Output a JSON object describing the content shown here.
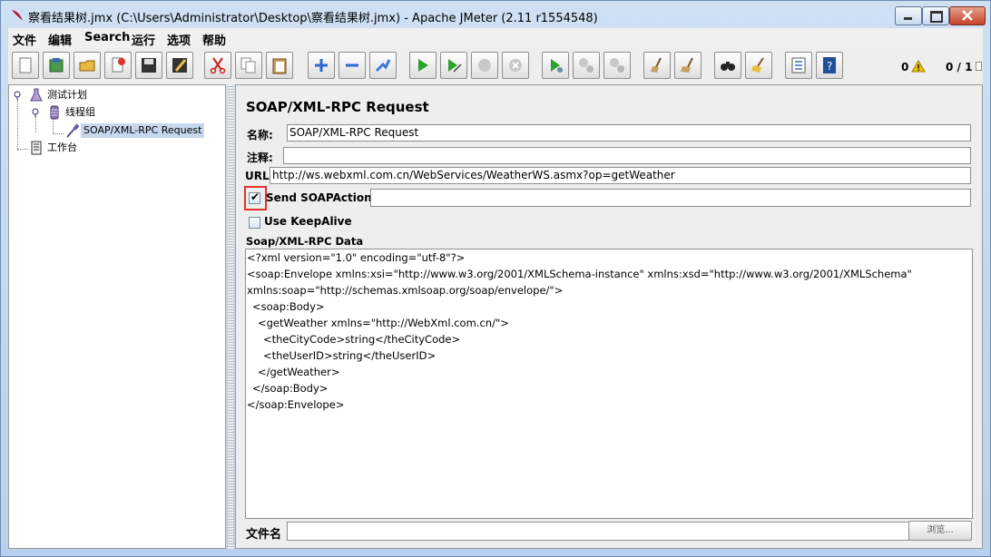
{
  "window": {
    "title": "察看结果树.jmx (C:\\Users\\Administrator\\Desktop\\察看结果树.jmx) - Apache JMeter (2.11 r1554548)"
  },
  "menu": [
    "文件",
    "编辑",
    "Search",
    "运行",
    "选项",
    "帮助"
  ],
  "toolbar": {
    "buttons": [
      "new-icon",
      "templates-icon",
      "open-icon",
      "close-icon",
      "save-icon",
      "save-as-icon",
      "cut-icon",
      "copy-icon",
      "paste-icon",
      "expand-icon",
      "collapse-icon",
      "toggle-icon",
      "start-icon",
      "start-no-pause-icon",
      "stop-icon",
      "shutdown-icon",
      "remote-start-icon",
      "remote-stop-icon",
      "remote-shutdown-icon",
      "clear-icon",
      "clear-all-icon",
      "search-icon",
      "reset-search-icon",
      "function-helper-icon",
      "help-icon"
    ],
    "warning_count": "0",
    "threads": "0 / 1"
  },
  "tree": {
    "nodes": [
      {
        "label": "测试计划",
        "icon": "test-plan-icon"
      },
      {
        "label": "线程组",
        "icon": "thread-group-icon"
      },
      {
        "label": "SOAP/XML-RPC Request",
        "icon": "sampler-pipette-icon"
      },
      {
        "label": "工作台",
        "icon": "workbench-icon"
      }
    ]
  },
  "sampler": {
    "heading": "SOAP/XML-RPC Request",
    "name_label": "名称:",
    "name_value": "SOAP/XML-RPC Request",
    "comment_label": "注释:",
    "comment_value": "",
    "url_label": "URL",
    "url_value": "http://ws.webxml.com.cn/WebServices/WeatherWS.asmx?op=getWeather",
    "send_soapaction_label": "Send SOAPAction:",
    "send_soapaction_checked": "✔",
    "soapaction_value": "",
    "keepalive_label": "Use KeepAlive",
    "data_label": "Soap/XML-RPC Data",
    "data_lines": [
      "<?xml version=\"1.0\" encoding=\"utf-8\"?>",
      "<soap:Envelope xmlns:xsi=\"http://www.w3.org/2001/XMLSchema-instance\" xmlns:xsd=\"http://www.w3.org/2001/XMLSchema\"",
      "xmlns:soap=\"http://schemas.xmlsoap.org/soap/envelope/\">",
      "  <soap:Body>",
      "    <getWeather xmlns=\"http://WebXml.com.cn/\">",
      "      <theCityCode>string</theCityCode>",
      "      <theUserID>string</theUserID>",
      "    </getWeather>",
      "  </soap:Body>",
      "</soap:Envelope>"
    ],
    "filename_label": "文件名",
    "filename_value": "",
    "browse_label": "浏览..."
  },
  "colors": {
    "selection": "#c7d7ee",
    "highlight_border": "#e53030"
  }
}
